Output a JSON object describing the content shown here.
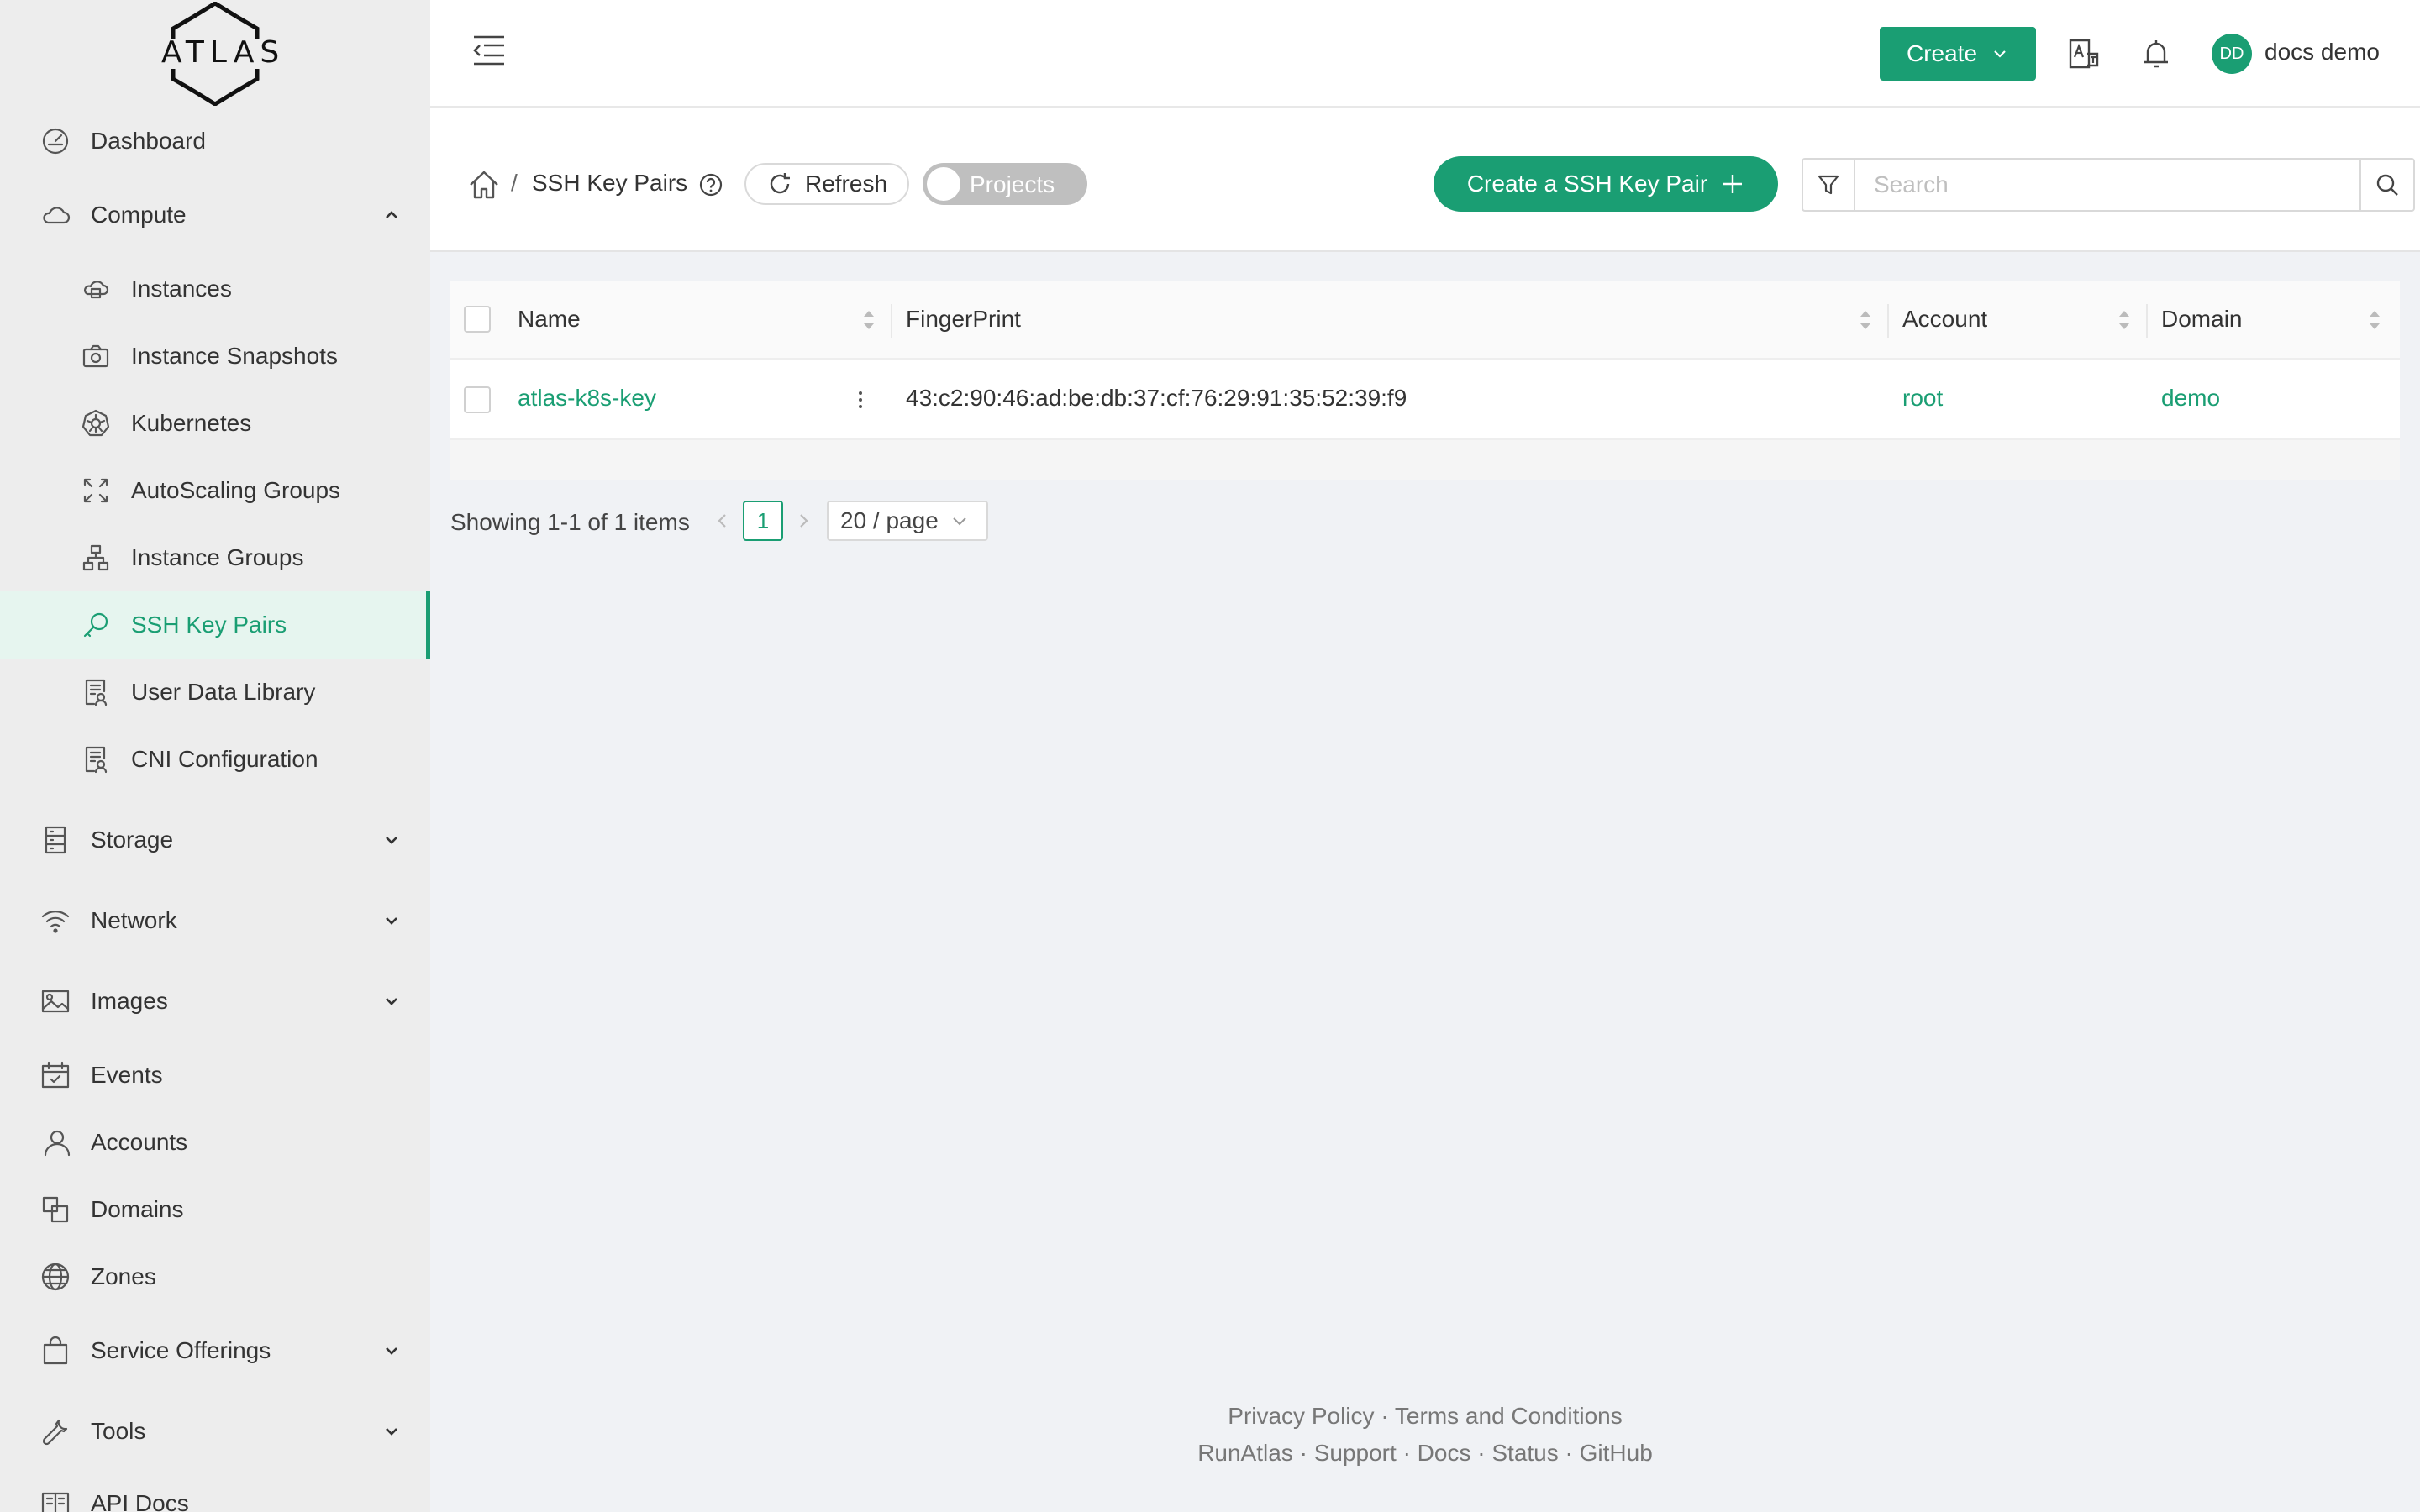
{
  "app": {
    "logo_text": "ATLAS"
  },
  "sidebar": {
    "items": [
      {
        "label": "Dashboard",
        "icon": "dashboard-icon"
      },
      {
        "label": "Compute",
        "icon": "cloud-icon",
        "expanded": true
      },
      {
        "label": "Instances",
        "icon": "instances-icon"
      },
      {
        "label": "Instance Snapshots",
        "icon": "camera-icon"
      },
      {
        "label": "Kubernetes",
        "icon": "kubernetes-icon"
      },
      {
        "label": "AutoScaling Groups",
        "icon": "autoscale-icon"
      },
      {
        "label": "Instance Groups",
        "icon": "instance-groups-icon"
      },
      {
        "label": "SSH Key Pairs",
        "icon": "key-icon",
        "active": true
      },
      {
        "label": "User Data Library",
        "icon": "document-icon"
      },
      {
        "label": "CNI Configuration",
        "icon": "document-icon"
      },
      {
        "label": "Storage",
        "icon": "storage-icon"
      },
      {
        "label": "Network",
        "icon": "wifi-icon"
      },
      {
        "label": "Images",
        "icon": "image-icon"
      },
      {
        "label": "Events",
        "icon": "calendar-icon"
      },
      {
        "label": "Accounts",
        "icon": "user-icon"
      },
      {
        "label": "Domains",
        "icon": "domains-icon"
      },
      {
        "label": "Zones",
        "icon": "globe-icon"
      },
      {
        "label": "Service Offerings",
        "icon": "shopping-bag-icon"
      },
      {
        "label": "Tools",
        "icon": "wrench-icon"
      },
      {
        "label": "API Docs",
        "icon": "book-icon"
      }
    ]
  },
  "header": {
    "create_label": "Create",
    "avatar_initials": "DD",
    "username": "docs demo"
  },
  "toolbar": {
    "breadcrumb_sep": "/",
    "title": "SSH Key Pairs",
    "refresh_label": "Refresh",
    "projects_toggle_label": "Projects",
    "create_ssh_label": "Create a SSH Key Pair",
    "search_placeholder": "Search"
  },
  "table": {
    "columns": [
      "Name",
      "FingerPrint",
      "Account",
      "Domain"
    ],
    "rows": [
      {
        "name": "atlas-k8s-key",
        "fingerprint": "43:c2:90:46:ad:be:db:37:cf:76:29:91:35:52:39:f9",
        "account": "root",
        "domain": "demo"
      }
    ]
  },
  "pagination": {
    "summary": "Showing 1-1 of 1 items",
    "current_page": "1",
    "page_size": "20 / page"
  },
  "footer": {
    "line1": [
      "Privacy Policy",
      "Terms and Conditions"
    ],
    "line2": [
      "RunAtlas",
      "Support",
      "Docs",
      "Status",
      "GitHub"
    ],
    "separator": "·"
  },
  "colors": {
    "accent": "#1a9e73",
    "sidebar_bg": "#ededed",
    "page_bg": "#f0f2f5"
  }
}
